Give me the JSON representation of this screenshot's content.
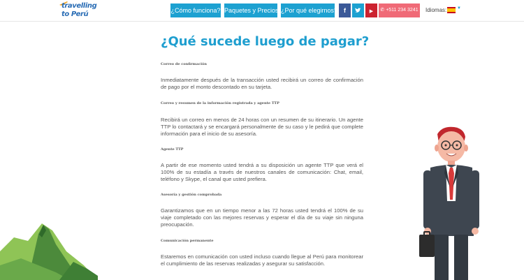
{
  "header": {
    "logo_line1": "travelling",
    "logo_line2": "to Perú",
    "nav": [
      "¿Cómo funciona?",
      "Paquetes y Precios",
      "¿Por qué elegirnos?"
    ],
    "social": [
      {
        "icon": "facebook-icon",
        "glyph": "f",
        "color": "#3b5998"
      },
      {
        "icon": "twitter-icon",
        "glyph": "t",
        "color": "#1da1d1"
      },
      {
        "icon": "youtube-icon",
        "glyph": "▶",
        "color": "#cc2230"
      }
    ],
    "phone": "+511 234 3241",
    "phone_icon": "phone-icon",
    "language_label": "Idiomas:",
    "accent_color": "#1da1d1",
    "phone_color": "#f06a77"
  },
  "content": {
    "title": "¿Qué sucede luego de pagar?",
    "sections": [
      {
        "label": "Correo de confirmación",
        "text": "Inmediatamente después de la transacción usted recibirá un correo de confirmación de pago por el monto descontado en su tarjeta."
      },
      {
        "label": "Correo y resumen de la información registrada y agente TTP",
        "text": "Recibirá un correo en menos de 24 horas con un resumen de su itinerario. Un agente TTP lo contactará y se encargará personalmente de su caso y le pedirá que complete información para el inicio de su asesoría."
      },
      {
        "label": "Agente TTP",
        "text": "A partir de ese momento usted tendrá a su disposición un agente TTP que verá el 100% de su estadía a través de nuestros canales de comunicación: Chat, email, teléfono y Skype, el canal que usted prefiera."
      },
      {
        "label": "Asesoría y gestión comprobada",
        "text": "Garantizamos que en un tiempo menor a las 72 horas usted tendrá el 100% de su viaje completado con las mejores reservas y esperar el día de su viaje sin ninguna preocupación."
      },
      {
        "label": "Comunicación permanente",
        "text": "Estaremos en comunicación con usted incluso cuando llegue al Perú para monitorear el cumplimiento de las reservas realizadas y asegurar su satisfacción."
      }
    ]
  }
}
